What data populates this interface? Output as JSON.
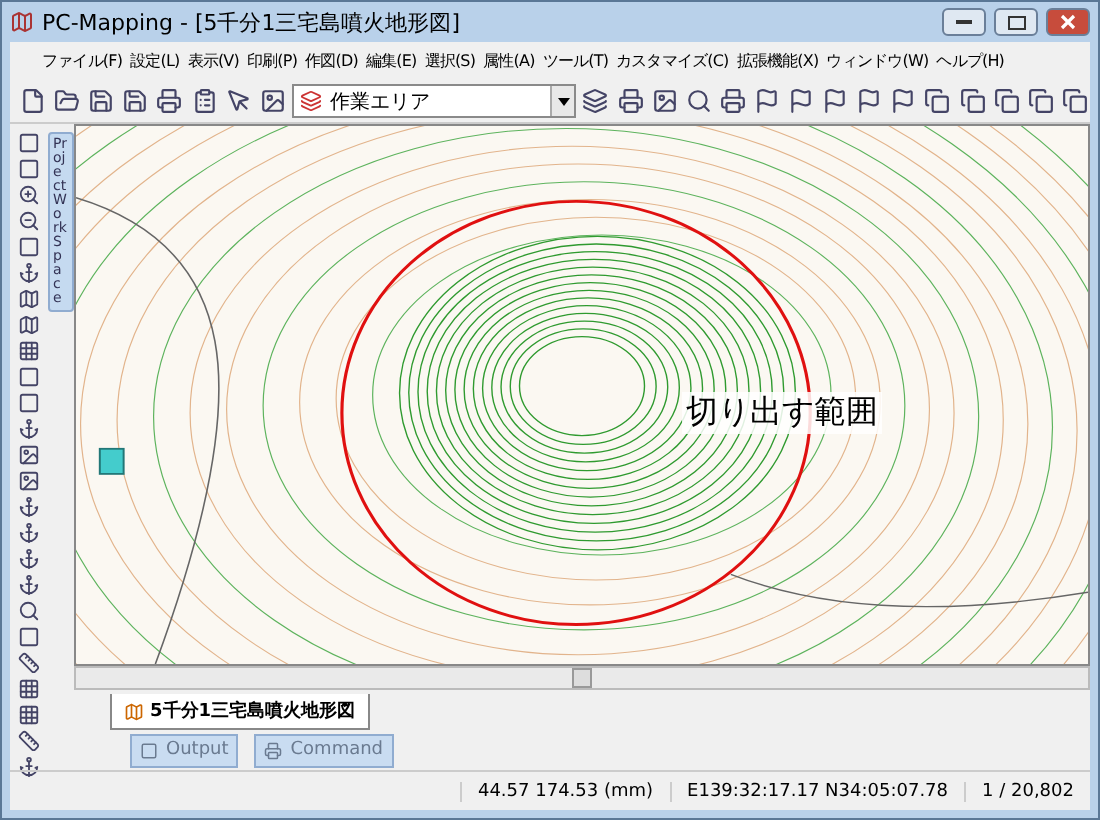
{
  "window": {
    "title": "PC-Mapping - [5千分1三宅島噴火地形図]"
  },
  "menu": [
    "ファイル(F)",
    "設定(L)",
    "表示(V)",
    "印刷(P)",
    "作図(D)",
    "編集(E)",
    "選択(S)",
    "属性(A)",
    "ツール(T)",
    "カスタマイズ(C)",
    "拡張機能(X)",
    "ウィンドウ(W)",
    "ヘルプ(H)"
  ],
  "layer_select": {
    "value": "作業エリア"
  },
  "side_panel": {
    "label": "ProjectWorkSpace"
  },
  "map": {
    "annotation": "切り出す範囲"
  },
  "document_tabs": [
    {
      "label": "5千分1三宅島噴火地形図",
      "selected": true
    }
  ],
  "bottom_tabs": [
    {
      "label": "Output",
      "selected": false
    },
    {
      "label": "Command",
      "selected": false
    }
  ],
  "status_bar": {
    "page_coords": "44.57 174.53 (mm)",
    "geo_coords": "E139:32:17.17 N34:05:07.78",
    "scale": "1 / 20,802"
  }
}
